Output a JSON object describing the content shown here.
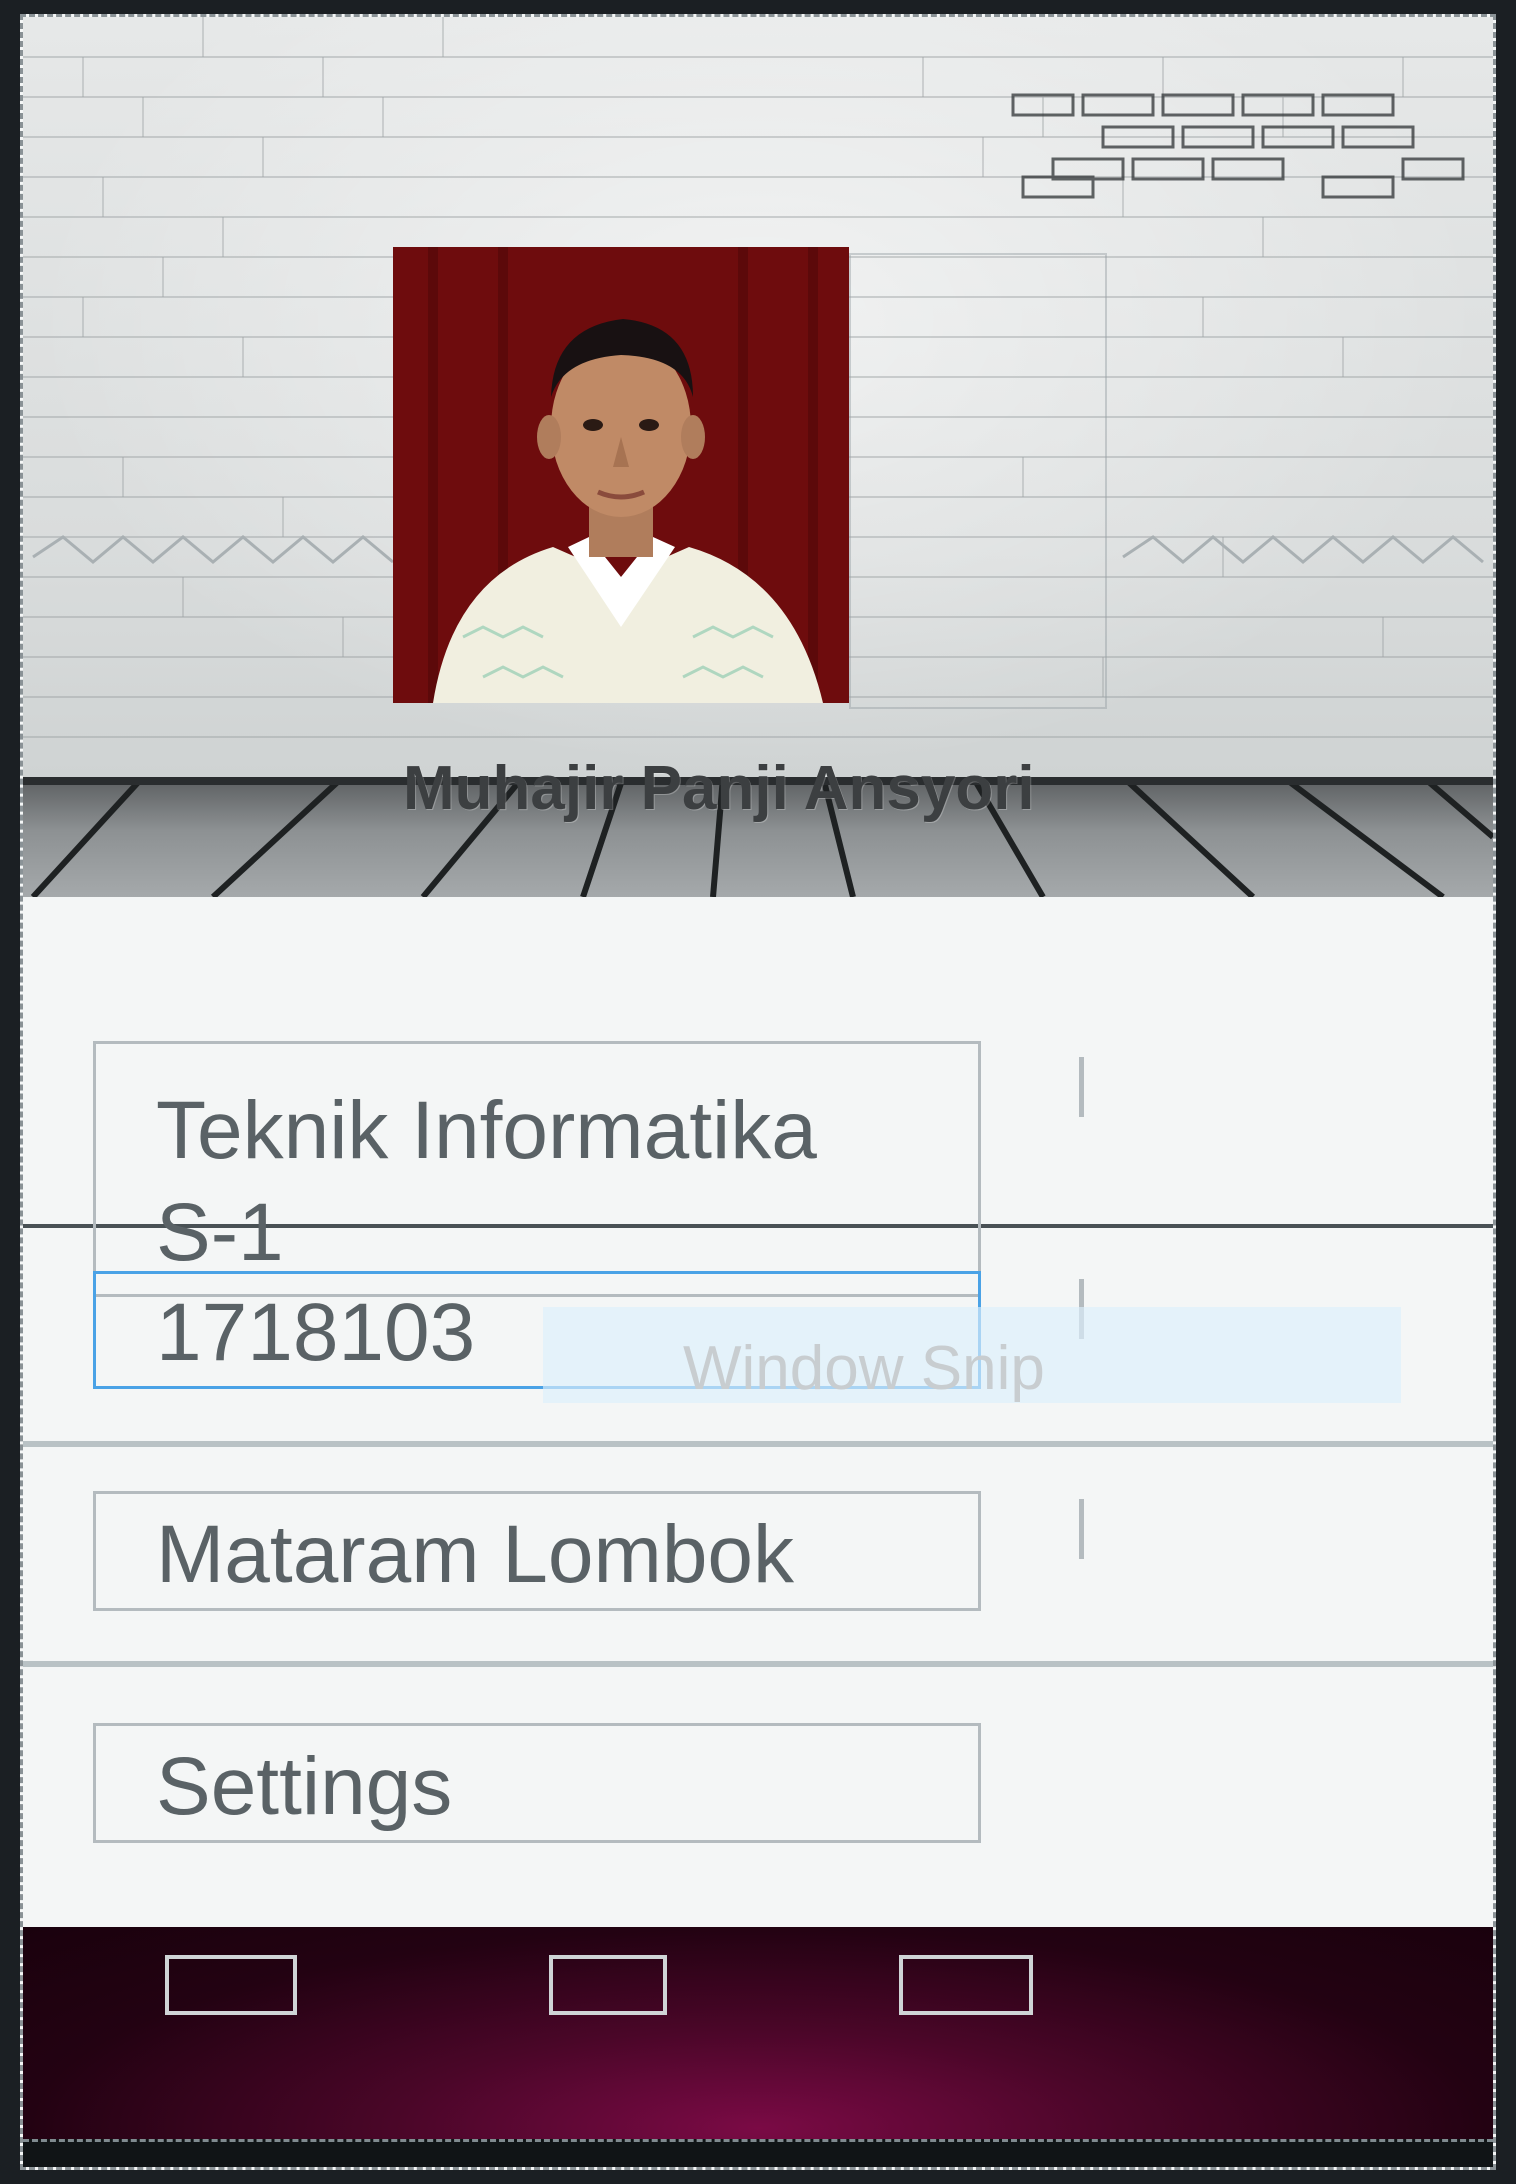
{
  "profile": {
    "name": "Muhajir Panji Ansyori",
    "photo_icon": "profile-photo"
  },
  "fields": [
    {
      "label": "Teknik Informatika S-1",
      "line1": "Teknik Informatika",
      "line2": "S-1"
    },
    {
      "label": "1718103"
    },
    {
      "label": "Mataram Lombok"
    },
    {
      "label": "Settings"
    }
  ],
  "overlay": {
    "label": "Window Snip"
  },
  "nav": {
    "buttons": [
      "back-button-icon",
      "home-button-icon",
      "recents-button-icon"
    ]
  },
  "colors": {
    "photo_background": "#7d0f10",
    "active_field_border": "#4aa2e6",
    "navbar_accent": "#7a0a45"
  }
}
